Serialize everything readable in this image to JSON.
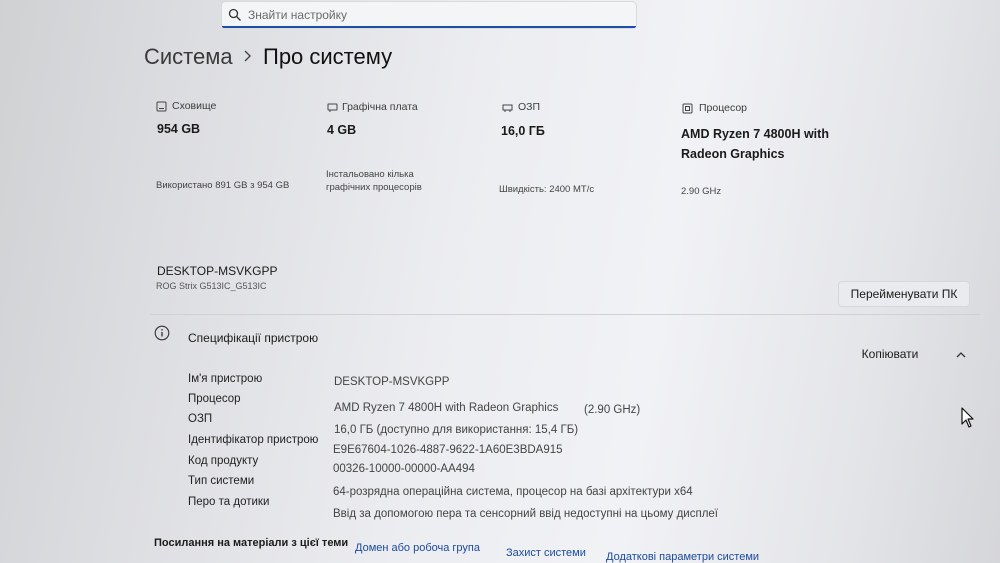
{
  "search": {
    "placeholder": "Знайти настройку"
  },
  "breadcrumb": {
    "parent": "Система",
    "current": "Про систему"
  },
  "tiles": [
    {
      "icon": "storage-icon",
      "label": "Сховище",
      "value": "954 GB",
      "sub": "Використано 891 GB з 954 GB"
    },
    {
      "icon": "graphics-card-icon",
      "label": "Графічна плата",
      "value": "4 GB",
      "sub": "Інстальовано кілька графічних процесорів"
    },
    {
      "icon": "ram-icon",
      "label": "ОЗП",
      "value": "16,0 ГБ",
      "sub": "Швидкість: 2400 МТ/с"
    },
    {
      "icon": "processor-icon",
      "label": "Процесор",
      "value": "AMD Ryzen 7 4800H with Radeon Graphics",
      "sub": "2.90 GHz"
    }
  ],
  "device": {
    "name": "DESKTOP-MSVKGPP",
    "model": "ROG Strix G513IC_G513IC",
    "rename_label": "Перейменувати ПК"
  },
  "specs": {
    "title": "Специфікації пристрою",
    "copy_label": "Копіювати",
    "rows": [
      {
        "label": "Ім'я пристрою",
        "value": "DESKTOP-MSVKGPP"
      },
      {
        "label": "Процесор",
        "value": "AMD Ryzen 7 4800H with Radeon Graphics",
        "extra": "(2.90 GHz)"
      },
      {
        "label": "ОЗП",
        "value": "16,0 ГБ (доступно для використання: 15,4 ГБ)"
      },
      {
        "label": "Ідентифікатор пристрою",
        "value": "E9E67604-1026-4887-9622-1A60E3BDA915"
      },
      {
        "label": "Код продукту",
        "value": "00326-10000-00000-AA494"
      },
      {
        "label": "Тип системи",
        "value": "64-розрядна операційна система, процесор на базі архітектури x64"
      },
      {
        "label": "Перо та дотики",
        "value": "Ввід за допомогою пера та сенсорний ввід недоступні на цьому дисплеї"
      }
    ]
  },
  "footer": {
    "title": "Посилання на матеріали з цієї теми",
    "links": [
      "Домен або робоча група",
      "Захист системи",
      "Додаткові параметри системи"
    ]
  }
}
